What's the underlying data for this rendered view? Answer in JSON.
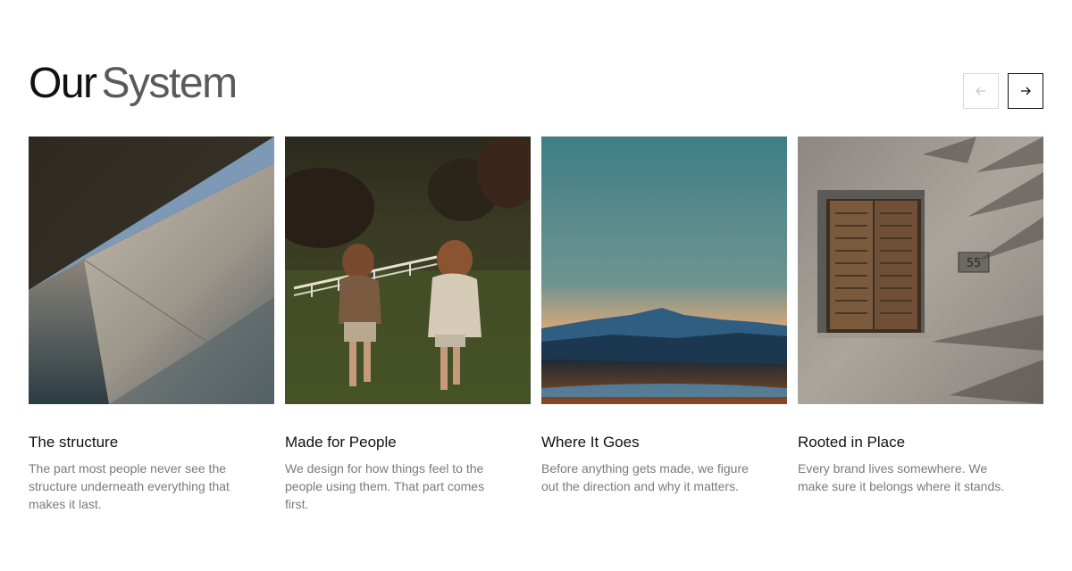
{
  "header": {
    "title_part1": "Our",
    "title_part2": "System"
  },
  "nav": {
    "prev_icon": "arrow-left-icon",
    "next_icon": "arrow-right-icon",
    "prev_disabled": true
  },
  "cards": [
    {
      "image": "concrete-architecture-photo",
      "title": "The structure",
      "description": "The part most people never see the structure underneath everything that makes it last."
    },
    {
      "image": "two-girls-running-field-photo",
      "title": "Made for People",
      "description": "We design for how things feel to the people using them. That part comes first."
    },
    {
      "image": "mountain-sunset-landscape-photo",
      "title": "Where It Goes",
      "description": "Before anything gets made, we figure out the direction and why it matters."
    },
    {
      "image": "wooden-shutter-window-wall-photo",
      "title": "Rooted in Place",
      "description": "Every brand lives somewhere. We make sure it belongs where it stands.",
      "house_number": "55"
    }
  ],
  "colors": {
    "text_primary": "#111111",
    "text_secondary": "#5a5a5a",
    "text_muted": "#7a7a7a"
  }
}
